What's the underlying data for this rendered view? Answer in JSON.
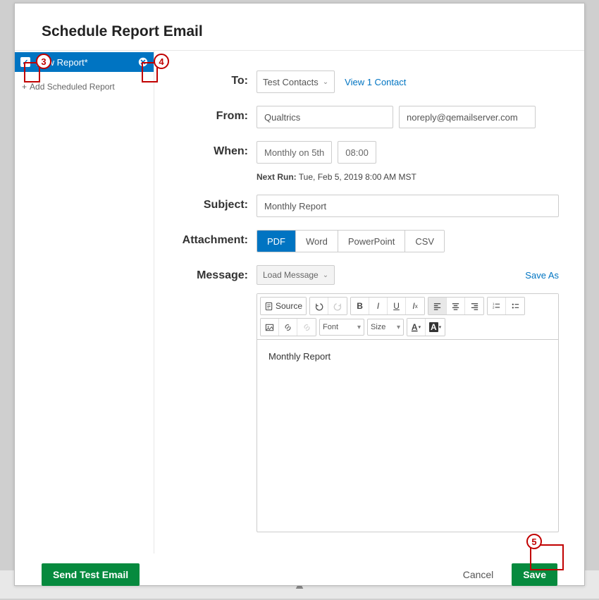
{
  "modal": {
    "title": "Schedule Report Email"
  },
  "sidebar": {
    "report_label": "New Report*",
    "add_label": "Add Scheduled Report"
  },
  "to": {
    "label": "To:",
    "selection": "Test Contacts",
    "link": "View 1 Contact"
  },
  "from": {
    "label": "From:",
    "name": "Qualtrics",
    "email": "noreply@qemailserver.com"
  },
  "when": {
    "label": "When:",
    "rule": "Monthly on 5th",
    "time": "08:00",
    "next_run_label": "Next Run:",
    "next_run_value": "Tue, Feb 5, 2019 8:00 AM MST"
  },
  "subject": {
    "label": "Subject:",
    "value": "Monthly Report"
  },
  "attachment": {
    "label": "Attachment:",
    "options": [
      "PDF",
      "Word",
      "PowerPoint",
      "CSV"
    ],
    "selected": "PDF"
  },
  "message": {
    "label": "Message:",
    "load": "Load Message",
    "save_as": "Save As",
    "body": "Monthly Report"
  },
  "toolbar": {
    "source": "Source",
    "font": "Font",
    "size": "Size"
  },
  "footer": {
    "test": "Send Test Email",
    "cancel": "Cancel",
    "save": "Save"
  },
  "annotations": {
    "a3": "3",
    "a4": "4",
    "a5": "5"
  }
}
